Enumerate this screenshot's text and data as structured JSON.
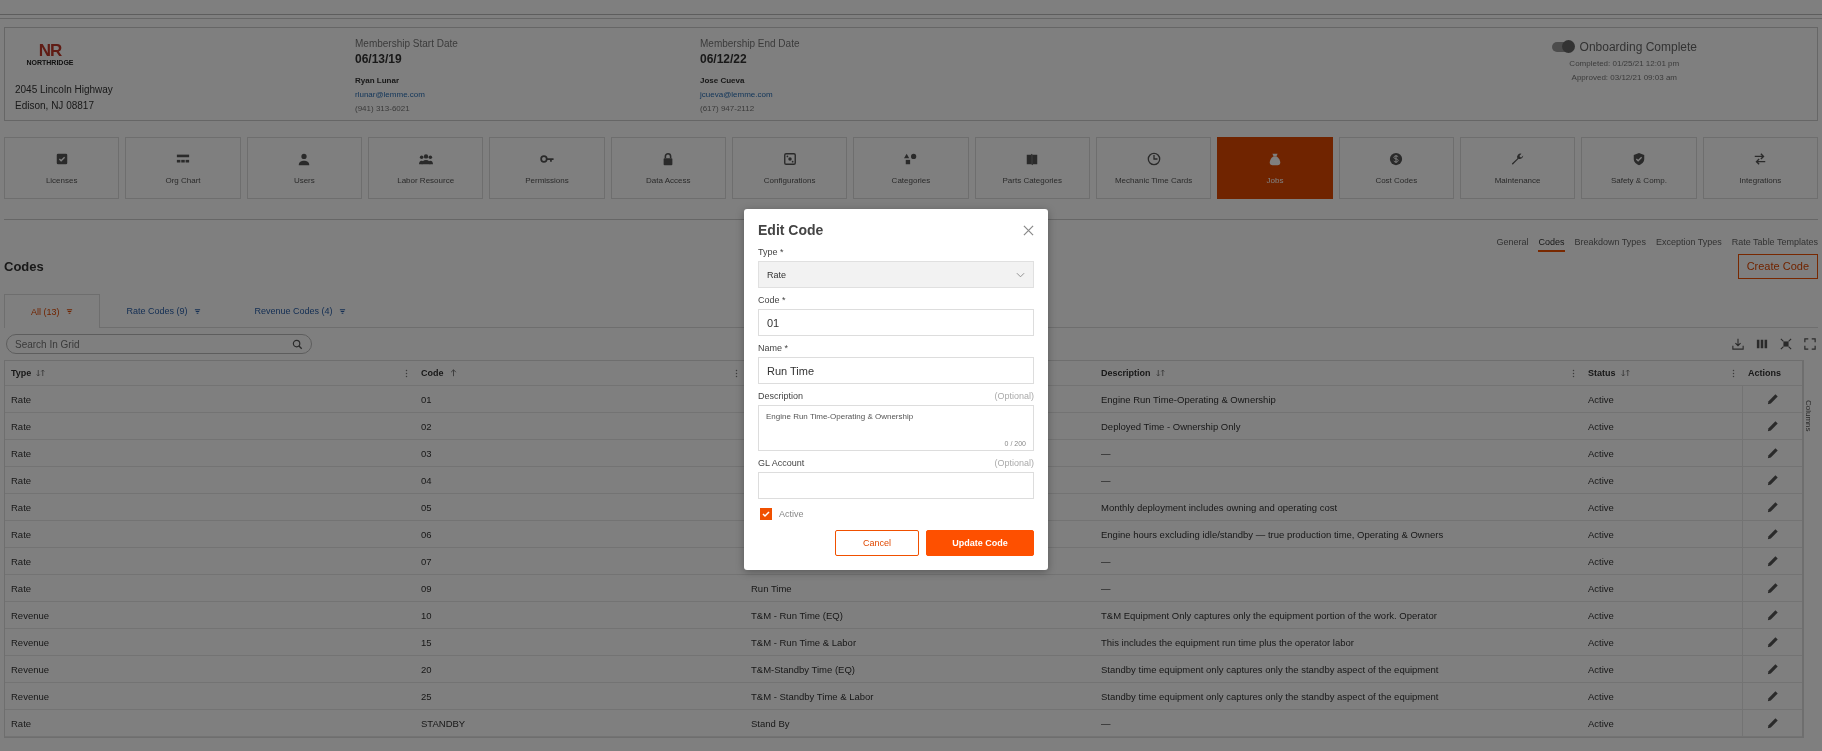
{
  "company": {
    "logo_mark": "NR",
    "logo_name": "NORTHRIDGE",
    "address_line1": "2045 Lincoln Highway",
    "address_line2": "Edison, NJ 08817"
  },
  "membership": [
    {
      "label": "Membership Start Date",
      "date": "06/13/19",
      "contact_name": "Ryan Lunar",
      "email": "rlunar@lemme.com",
      "phone": "(941) 313-6021"
    },
    {
      "label": "Membership End Date",
      "date": "06/12/22",
      "contact_name": "Jose Cueva",
      "email": "jcueva@lemme.com",
      "phone": "(617) 947-2112"
    }
  ],
  "onboarding": {
    "label": "Onboarding Complete",
    "on": true,
    "completed": "Completed: 01/25/21 12:01 pm",
    "approved": "Approved: 03/12/21 09:03 am"
  },
  "nav_tiles": [
    {
      "label": "Licenses",
      "selected": false
    },
    {
      "label": "Org Chart",
      "selected": false
    },
    {
      "label": "Users",
      "selected": false
    },
    {
      "label": "Labor Resource",
      "selected": false
    },
    {
      "label": "Permissions",
      "selected": false
    },
    {
      "label": "Data Access",
      "selected": false
    },
    {
      "label": "Configurations",
      "selected": false
    },
    {
      "label": "Categories",
      "selected": false
    },
    {
      "label": "Parts Categories",
      "selected": false
    },
    {
      "label": "Mechanic Time Cards",
      "selected": false
    },
    {
      "label": "Jobs",
      "selected": true
    },
    {
      "label": "Cost Codes",
      "selected": false
    },
    {
      "label": "Maintenance",
      "selected": false
    },
    {
      "label": "Safety & Comp.",
      "selected": false
    },
    {
      "label": "Integrations",
      "selected": false
    }
  ],
  "sub_tabs": [
    {
      "label": "General",
      "selected": false
    },
    {
      "label": "Codes",
      "selected": true
    },
    {
      "label": "Breakdown Types",
      "selected": false
    },
    {
      "label": "Exception Types",
      "selected": false
    },
    {
      "label": "Rate Table Templates",
      "selected": false
    }
  ],
  "page_title": "Codes",
  "create_button": "Create Code",
  "grid_tabs": [
    {
      "label": "All (13)",
      "selected": true
    },
    {
      "label": "Rate Codes (9)",
      "selected": false
    },
    {
      "label": "Revenue Codes (4)",
      "selected": false
    }
  ],
  "search": {
    "placeholder": "Search In Grid"
  },
  "side_panel_tab": "Columns",
  "table": {
    "columns": [
      {
        "label": "Type",
        "sortable": true,
        "sorted": false
      },
      {
        "label": "Code",
        "sortable": true,
        "sorted": true
      },
      {
        "label": "Description",
        "sortable": true,
        "sorted": false
      },
      {
        "label": "Status",
        "sortable": true,
        "sorted": false
      },
      {
        "label": "Actions",
        "sortable": false,
        "sorted": false
      }
    ],
    "rows": [
      {
        "type": "Rate",
        "code": "01",
        "description": "Engine Run Time-Operating & Ownership",
        "status": "Active"
      },
      {
        "type": "Rate",
        "code": "02",
        "description": "Deployed Time - Ownership Only",
        "status": "Active"
      },
      {
        "type": "Rate",
        "code": "03",
        "description": "—",
        "status": "Active"
      },
      {
        "type": "Rate",
        "code": "04",
        "description": "—",
        "status": "Active"
      },
      {
        "type": "Rate",
        "code": "05",
        "description": "Monthly deployment includes owning and operating cost",
        "status": "Active"
      },
      {
        "type": "Rate",
        "code": "06",
        "description": "Engine hours excluding idle/standby — true production time, Operating & Owners",
        "status": "Active"
      },
      {
        "type": "Rate",
        "code": "07",
        "description": "—",
        "status": "Active"
      },
      {
        "type": "Rate",
        "code": "09",
        "name": "Run Time",
        "description": "—",
        "status": "Active"
      },
      {
        "type": "Revenue",
        "code": "10",
        "name": "T&M - Run Time (EQ)",
        "description": "T&M Equipment Only captures only the equipment portion of the work. Operator",
        "status": "Active"
      },
      {
        "type": "Revenue",
        "code": "15",
        "name": "T&M - Run Time & Labor",
        "description": "This includes the equipment run time plus the operator labor",
        "status": "Active"
      },
      {
        "type": "Revenue",
        "code": "20",
        "name": "T&M-Standby Time (EQ)",
        "description": "Standby time equipment only captures only the standby aspect of the equipment",
        "status": "Active"
      },
      {
        "type": "Revenue",
        "code": "25",
        "name": "T&M - Standby Time & Labor",
        "description": "Standby time equipment only captures only the standby aspect of the equipment",
        "status": "Active"
      },
      {
        "type": "Rate",
        "code": "STANDBY",
        "name": "Stand By",
        "description": "—",
        "status": "Active"
      }
    ]
  },
  "modal": {
    "title": "Edit Code",
    "type_field": {
      "label": "Type *",
      "value": "Rate"
    },
    "code_field": {
      "label": "Code *",
      "value": "01"
    },
    "name_field": {
      "label": "Name *",
      "value": "Run Time"
    },
    "description_field": {
      "label": "Description",
      "optional": "(Optional)",
      "value": "Engine Run Time-Operating & Ownership",
      "counter": "0 / 200"
    },
    "gl_field": {
      "label": "GL Account",
      "optional": "(Optional)"
    },
    "active": {
      "label": "Active",
      "checked": true
    },
    "buttons": [
      {
        "label": "Cancel",
        "kind": "secondary"
      },
      {
        "label": "Update Code",
        "kind": "primary"
      }
    ]
  }
}
